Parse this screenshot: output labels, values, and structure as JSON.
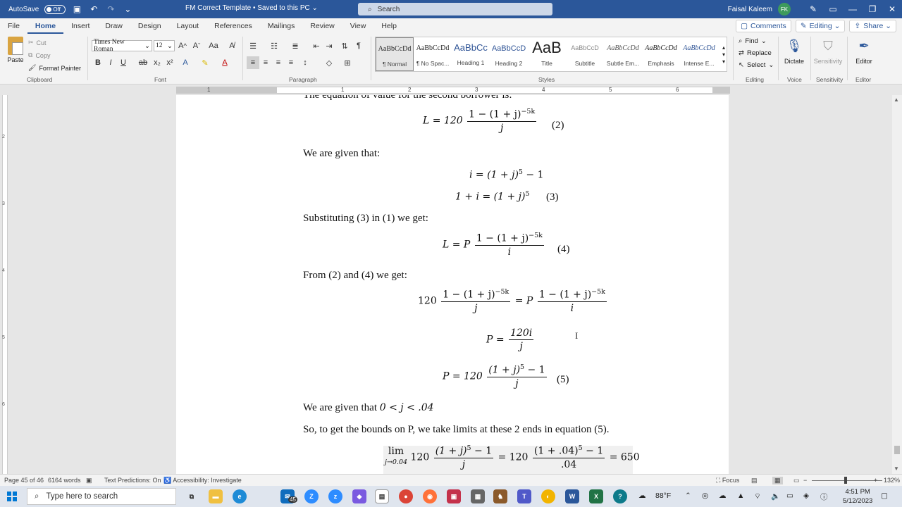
{
  "titlebar": {
    "autosave_label": "AutoSave",
    "autosave_state": "Off",
    "doc_title": "FM Correct Template • Saved to this PC ⌄",
    "search_placeholder": "Search",
    "user_name": "Faisal Kaleem",
    "user_initials": "FK"
  },
  "tabs": [
    "File",
    "Home",
    "Insert",
    "Draw",
    "Design",
    "Layout",
    "References",
    "Mailings",
    "Review",
    "View",
    "Help"
  ],
  "ribbon_actions": {
    "comments": "Comments",
    "editing": "Editing ⌄",
    "share": "Share ⌄"
  },
  "clipboard": {
    "paste": "Paste",
    "cut": "Cut",
    "copy": "Copy",
    "format_painter": "Format Painter",
    "label": "Clipboard"
  },
  "font": {
    "name": "Times New Roman",
    "size": "12",
    "label": "Font"
  },
  "paragraph": {
    "label": "Paragraph"
  },
  "styles": {
    "label": "Styles",
    "items": [
      {
        "preview": "AaBbCcDd",
        "name": "¶ Normal"
      },
      {
        "preview": "AaBbCcDd",
        "name": "¶ No Spac..."
      },
      {
        "preview": "AaBbCc",
        "name": "Heading 1"
      },
      {
        "preview": "AaBbCcD",
        "name": "Heading 2"
      },
      {
        "preview": "AaB",
        "name": "Title"
      },
      {
        "preview": "AaBbCcD",
        "name": "Subtitle"
      },
      {
        "preview": "AaBbCcDd",
        "name": "Subtle Em..."
      },
      {
        "preview": "AaBbCcDd",
        "name": "Emphasis"
      },
      {
        "preview": "AaBbCcDd",
        "name": "Intense E..."
      }
    ]
  },
  "editing": {
    "find": "Find",
    "replace": "Replace",
    "select": "Select",
    "label": "Editing"
  },
  "voice": {
    "dictate": "Dictate",
    "label": "Voice"
  },
  "sensitivity": {
    "button": "Sensitivity",
    "label": "Sensitivity"
  },
  "editor": {
    "button": "Editor",
    "label": "Editor"
  },
  "ruler": {
    "numbers": [
      "1",
      "1",
      "2",
      "3",
      "4",
      "5",
      "6"
    ]
  },
  "vruler": {
    "numbers": [
      "2",
      "3",
      "4",
      "5",
      "6"
    ]
  },
  "document": {
    "line_top": "The equation of value for the second borrower is:",
    "eq2": {
      "lhs": "L = 120",
      "num": "1 − (1 + j)",
      "num_exp": "−5k",
      "den": "j",
      "no": "(2)"
    },
    "given1": "We are given that:",
    "eq_i": {
      "text": "i = (1 + j)",
      "exp": "5",
      "tail": " − 1"
    },
    "eq3": {
      "text": "1 + i = (1 + j)",
      "exp": "5",
      "no": "(3)"
    },
    "subst": "Substituting (3) in (1) we get:",
    "eq4": {
      "lhs": "L = P",
      "num": "1 − (1 + j)",
      "num_exp": "−5k",
      "den": "i",
      "no": "(4)"
    },
    "from": "From (2) and (4) we get:",
    "eq_combined": {
      "lhs": "120",
      "num": "1 − (1 + j)",
      "num_exp": "−5k",
      "den1": "j",
      "mid": "= P",
      "den2": "i"
    },
    "eq_p1": {
      "lhs": "P =",
      "num": "120i",
      "den": "j"
    },
    "eq5": {
      "lhs": "P = 120",
      "num": "(1 + j)",
      "num_exp": "5",
      "num_tail": " − 1",
      "den": "j",
      "no": "(5)"
    },
    "given2": "We are given that ",
    "given2_math": "0 < j < .04",
    "bounds": "So, to get the bounds on P, we take limits at these 2 ends in equation (5).",
    "eq_lim": {
      "lim": "lim",
      "sub": "j→0.04",
      "c1": "120",
      "num1": "(1 + j)",
      "exp": "5",
      "num1_tail": " − 1",
      "den1": "j",
      "c2": "= 120",
      "num2": "(1 + .04)",
      "num2_tail": " − 1",
      "den2": ".04",
      "result": "= 650"
    }
  },
  "status": {
    "page": "Page 45 of 46",
    "words": "6164 words",
    "predictions": "Text Predictions: On",
    "accessibility": "Accessibility: Investigate",
    "focus": "Focus",
    "zoom": "132%",
    "zoom_fraction": 0.46
  },
  "taskbar": {
    "search_placeholder": "Type here to search",
    "weather": "88°F",
    "time": "4:51 PM",
    "date": "5/12/2023",
    "mail_badge": "45"
  }
}
